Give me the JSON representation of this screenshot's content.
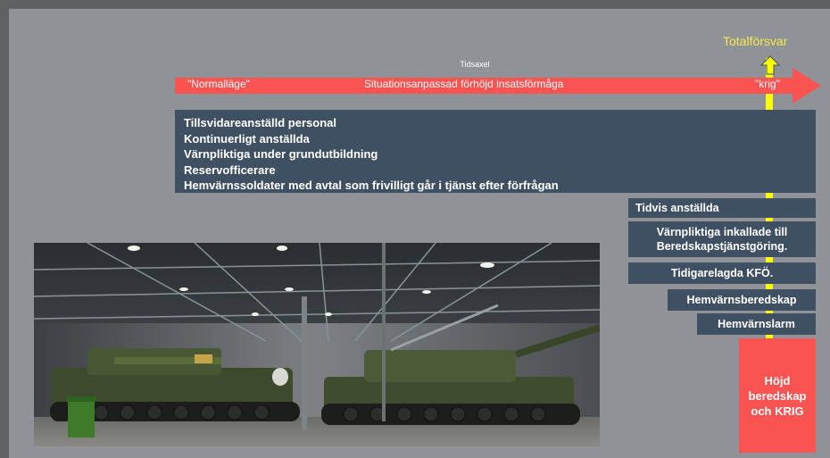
{
  "timeline": {
    "axis_label": "Tidsaxel",
    "total_label": "Totalförsvar",
    "start_label": "\"Normalläge\"",
    "middle_label": "Situationsanpassad förhöjd insatsförmåga",
    "end_label": "\"krig\"",
    "arrow_color": "#f95452",
    "line_color": "#ffff00"
  },
  "main_box": {
    "lines": [
      "Tillsvidareanställd personal",
      "Kontinuerligt anställda",
      "Värnpliktiga under grundutbildning",
      "Reservofficerare",
      "Hemvärnssoldater med avtal som frivilligt går i tjänst efter förfrågan"
    ]
  },
  "side_boxes": [
    "Tidvis anställda",
    "Värnpliktiga inkallade till Beredskapstjänstgöring.",
    "Tidigarelagda KFÖ.",
    "Hemvärnsberedskap",
    "Hemvärnslarm"
  ],
  "red_box": {
    "line1": "Höjd",
    "line2": "beredskap",
    "line3": "och KRIG"
  },
  "colors": {
    "box_blue": "#3f5062",
    "background": "#8f9296",
    "red": "#f95452"
  }
}
